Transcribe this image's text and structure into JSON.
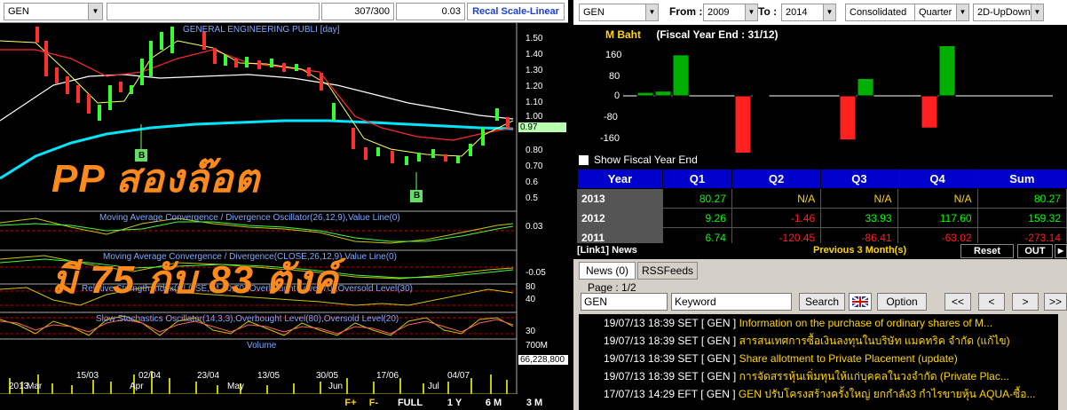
{
  "left": {
    "symbol": "GEN",
    "count": "307/300",
    "value": "0.03",
    "recal": "Recal Scale-Linear",
    "chart_title": "GENERAL ENGINEERING PUBLI [day]",
    "price_axis": [
      "1.50",
      "1.40",
      "1.30",
      "1.20",
      "1.10",
      "1.00",
      "0.97",
      "0.80",
      "0.70",
      "0.6",
      "0.5"
    ],
    "current_price": "0.97",
    "buy_marker": "B",
    "macd_title": "Moving Average Convergence / Divergence Oscillator(26,12,9),Value Line(0)",
    "macd_axis": "0.03",
    "macd2_title": "Moving Average Convergence / Divergence(CLOSE,26,12,9),Value Line(0)",
    "macd2_axis": "-0.05",
    "rsi_title": "Relative Strength Index(CLOSE,14,30,70),Overbought Level(70),Oversold Level(30)",
    "rsi_axis": [
      "80",
      "40"
    ],
    "stoch_title": "Slow Stochastics Oscillator(14,3,3),Overbought Level(80),Oversold Level(20)",
    "stoch_axis": [
      "30"
    ],
    "volume_title": "Volume",
    "volume_axis": "700M",
    "volume_value": "66,228,800",
    "dates": [
      "2013",
      "Mar",
      "15/03",
      "Apr",
      "02/04",
      "23/04",
      "May",
      "13/05",
      "30/05",
      "Jun",
      "17/06",
      "Jul",
      "04/07"
    ],
    "overlay_line1": "PP สองล๊อต",
    "overlay_line2": "มี 75 กับ 83 ตังค์",
    "bottom_buttons": [
      "F+",
      "F-",
      "FULL",
      "1 Y",
      "6 M",
      "3 M"
    ]
  },
  "fin": {
    "symbol": "GEN",
    "from_label": "From :",
    "from_value": "2009",
    "to_label": "To :",
    "to_value": "2014",
    "consolidated": "Consolidated",
    "period": "Quarter",
    "view": "2D-UpDown",
    "unit": "M Baht",
    "fiscal": "(Fiscal Year End : 31/12)",
    "y_axis": [
      "160",
      "80",
      "0",
      "-80",
      "-160"
    ],
    "show_fy": "Show Fiscal Year End",
    "headers": [
      "Year",
      "Q1",
      "Q2",
      "Q3",
      "Q4",
      "Sum"
    ],
    "rows": [
      {
        "year": "2013",
        "q1": "80.27",
        "q2": "N/A",
        "q3": "N/A",
        "q4": "N/A",
        "sum": "80.27"
      },
      {
        "year": "2012",
        "q1": "9.26",
        "q2": "-1.46",
        "q3": "33.93",
        "q4": "117.60",
        "sum": "159.32"
      },
      {
        "year": "2011",
        "q1": "6.74",
        "q2": "-120.45",
        "q3": "-86.41",
        "q4": "-63.02",
        "sum": "-273.14"
      }
    ],
    "colors": {
      "up": "#00b000",
      "down": "#ff2020"
    }
  },
  "news": {
    "link": "[Link1] News",
    "period": "Previous 3 Month(s)",
    "reset": "Reset",
    "out": "OUT",
    "tab_news": "News (0)",
    "tab_rss": "RSSFeeds",
    "page": "Page : 1/2",
    "symbol": "GEN",
    "keyword": "Keyword",
    "search": "Search",
    "option": "Option",
    "nav": [
      "<<",
      "<",
      ">",
      ">>"
    ],
    "items": [
      {
        "date": "19/07/13 18:39",
        "src": "SET",
        "sym": "[ GEN ]",
        "headline": "Information on the purchase of ordinary shares of M..."
      },
      {
        "date": "19/07/13 18:39",
        "src": "SET",
        "sym": "[ GEN ]",
        "headline": "สารสนเทศการซื้อเงินลงทุนในบริษัท แมคทริค จำกัด (แก้ไข)"
      },
      {
        "date": "19/07/13 18:39",
        "src": "SET",
        "sym": "[ GEN ]",
        "headline": "Share allotment to Private Placement (update)"
      },
      {
        "date": "19/07/13 18:39",
        "src": "SET",
        "sym": "[ GEN ]",
        "headline": "การจัดสรรหุ้นเพิ่มทุนให้แก่บุคคลในวงจำกัด (Private Plac..."
      },
      {
        "date": "17/07/13 14:29",
        "src": "EFT",
        "sym": "[ GEN ]",
        "headline": "GEN ปรับโครงสร้างครั้งใหญ่ ยกกำลัง3 กำไรขายหุ้น AQUA-ซื้อ..."
      }
    ]
  }
}
